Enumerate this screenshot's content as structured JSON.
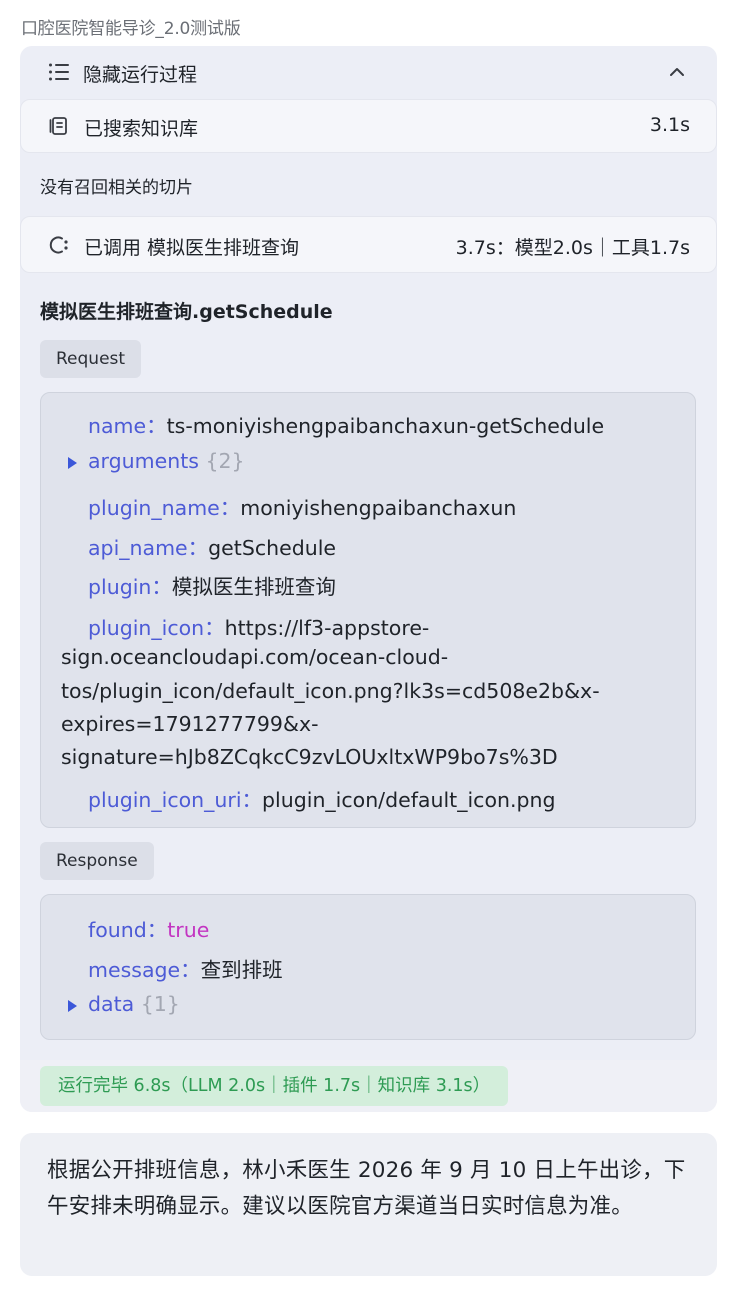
{
  "app": {
    "title": "口腔医院智能导诊_2.0测试版"
  },
  "process": {
    "hide_label": "隐藏运行过程",
    "icons": {
      "list": "list-icon",
      "chevron": "chevron-up-icon"
    }
  },
  "steps": {
    "knowledge": {
      "label": "已搜索知识库",
      "time": "3.1s",
      "icon": "knowledge-base-icon"
    },
    "no_recall": "没有召回相关的切片",
    "plugin": {
      "label": "已调用 模拟医生排班查询",
      "time": "3.7s：模型2.0s｜工具1.7s",
      "icon": "plugin-icon"
    }
  },
  "function_call": {
    "title": "模拟医生排班查询.getSchedule",
    "request_tag": "Request",
    "request": {
      "name_key": "name",
      "name_value": "ts-moniyishengpaibanchaxun-getSchedule",
      "arguments_key": "arguments",
      "arguments_count": "{2}",
      "plugin_name_key": "plugin_name",
      "plugin_name_value": "moniyishengpaibanchaxun",
      "api_name_key": "api_name",
      "api_name_value": "getSchedule",
      "plugin_key": "plugin",
      "plugin_value": "模拟医生排班查询",
      "plugin_icon_key": "plugin_icon",
      "plugin_icon_value_lines": [
        "https://lf3-appstore-",
        "sign.oceancloudapi.com/ocean-cloud-",
        "tos/plugin_icon/default_icon.png?lk3s=cd508e2b&x-",
        "expires=1791277799&x-",
        "signature=hJb8ZCqkcC9zvLOUxltxWP9bo7s%3D"
      ],
      "plugin_icon_uri_key": "plugin_icon_uri",
      "plugin_icon_uri_value": "plugin_icon/default_icon.png"
    },
    "response_tag": "Response",
    "response": {
      "found_key": "found",
      "found_value": "true",
      "message_key": "message",
      "message_value": "查到排班",
      "data_key": "data",
      "data_count": "{1}"
    },
    "colon": "："
  },
  "status": {
    "summary": "运行完毕 6.8s（LLM 2.0s｜插件 1.7s｜知识库 3.1s）"
  },
  "answer": {
    "text": "根据公开排班信息，林小禾医生 2026 年 9 月 10 日上午出诊，下午安排未明确显示。建议以医院官方渠道当日实时信息为准。"
  },
  "colors": {
    "key": "#4d5bd6",
    "true_value": "#c335c2",
    "status_green": "#2e9b53",
    "status_bg": "#d3eedb"
  }
}
